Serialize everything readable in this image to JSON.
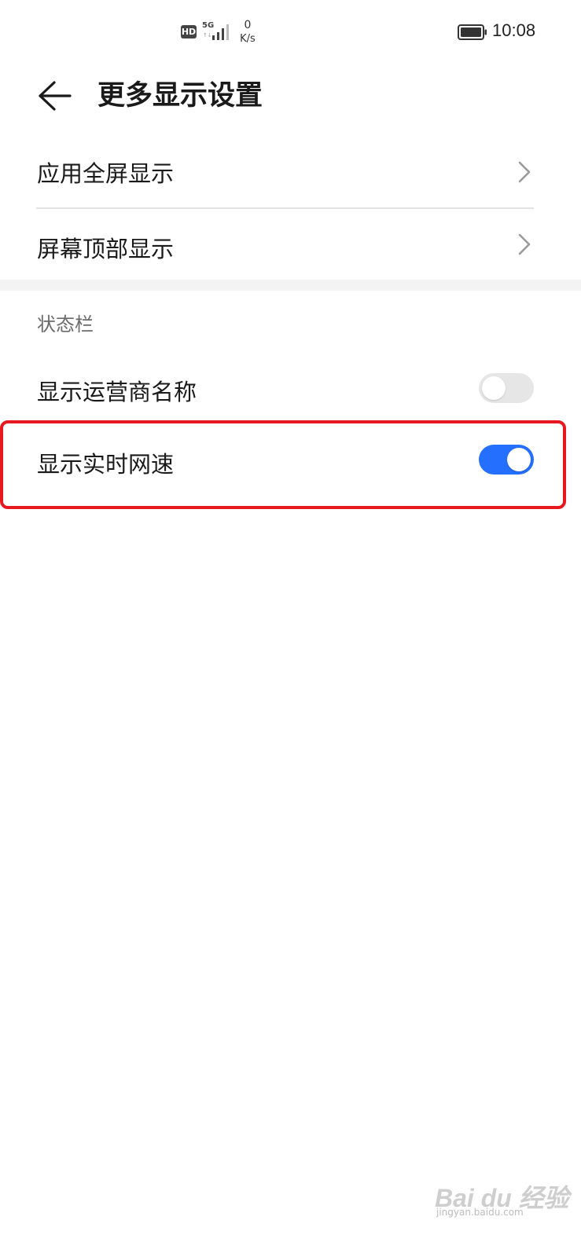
{
  "status_bar": {
    "hd_badge": "HD",
    "network_type": "5G",
    "network_sub": "↑↓",
    "speed_value": "0",
    "speed_unit": "K/s",
    "time": "10:08",
    "icons": [
      "hd-icon",
      "signal-icon",
      "battery-icon"
    ]
  },
  "header": {
    "back_icon": "arrow-left-icon",
    "title": "更多显示设置"
  },
  "menu_items": [
    {
      "label": "应用全屏显示",
      "icon": "chevron-right-icon"
    },
    {
      "label": "屏幕顶部显示",
      "icon": "chevron-right-icon"
    }
  ],
  "section": {
    "title": "状态栏"
  },
  "toggles": [
    {
      "label": "显示运营商名称",
      "checked": false
    },
    {
      "label": "显示实时网速",
      "checked": true
    }
  ],
  "colors": {
    "accent": "#256fff",
    "toggle_off": "#e6e6e6",
    "highlight": "#e8191e",
    "section_gap": "#f3f3f3"
  },
  "watermark": {
    "text": "Bai du 经验",
    "sub": "jingyan.baidu.com"
  }
}
